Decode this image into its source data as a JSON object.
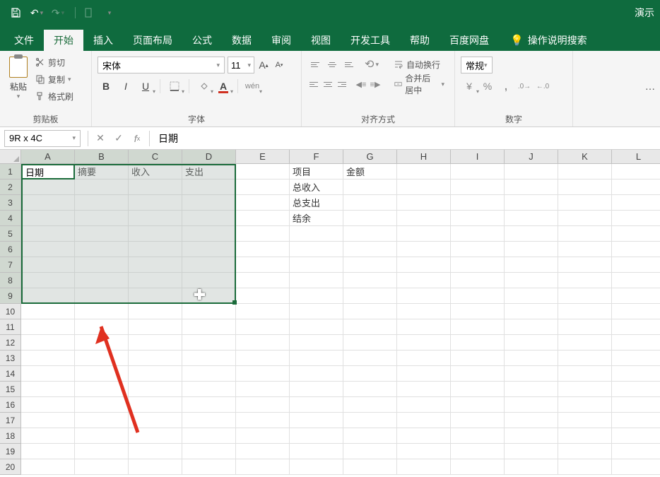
{
  "titlebar": {
    "right_text": "演示"
  },
  "tabs": {
    "file": "文件",
    "home": "开始",
    "insert": "插入",
    "layout": "页面布局",
    "formula": "公式",
    "data": "数据",
    "review": "审阅",
    "view": "视图",
    "dev": "开发工具",
    "help": "帮助",
    "baidu": "百度网盘",
    "tellme": "操作说明搜索"
  },
  "ribbon": {
    "clipboard": {
      "label": "剪贴板",
      "paste": "粘贴",
      "cut": "剪切",
      "copy": "复制",
      "format_painter": "格式刷"
    },
    "font": {
      "label": "字体",
      "name": "宋体",
      "size": "11"
    },
    "align": {
      "label": "对齐方式",
      "wrap": "自动换行",
      "merge": "合并后居中"
    },
    "number": {
      "label": "数字",
      "format": "常规"
    }
  },
  "formula_bar": {
    "name_box": "9R x 4C",
    "fx_value": "日期"
  },
  "grid": {
    "cols": [
      "A",
      "B",
      "C",
      "D",
      "E",
      "F",
      "G",
      "H",
      "I",
      "J",
      "K",
      "L"
    ],
    "rows": [
      "1",
      "2",
      "3",
      "4",
      "5",
      "6",
      "7",
      "8",
      "9",
      "10",
      "11",
      "12",
      "13",
      "14",
      "15",
      "16",
      "17",
      "18",
      "19",
      "20"
    ],
    "data": {
      "A1": "日期",
      "B1": "摘要",
      "C1": "收入",
      "D1": "支出",
      "F1": "项目",
      "G1": "金额",
      "F2": "总收入",
      "F3": "总支出",
      "F4": "结余"
    },
    "active_cell_text": "日期"
  }
}
